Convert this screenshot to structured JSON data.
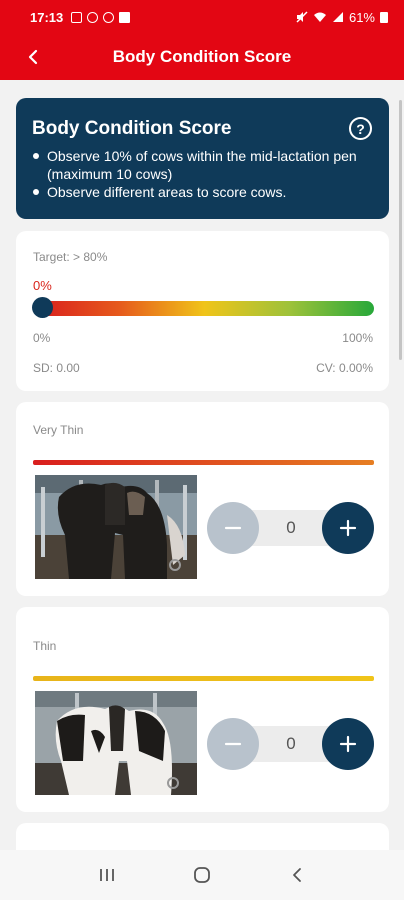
{
  "status_bar": {
    "time": "17:13",
    "battery": "61%"
  },
  "header": {
    "title": "Body Condition Score"
  },
  "info": {
    "title": "Body Condition Score",
    "help_glyph": "?",
    "bullets": [
      "Observe 10% of cows within the mid-lactation pen (maximum 10 cows)",
      "Observe different areas to score cows."
    ]
  },
  "summary": {
    "target": "Target: > 80%",
    "current_percent": "0%",
    "progress_fraction": 0,
    "scale_min": "0%",
    "scale_max": "100%",
    "sd": "SD: 0.00",
    "cv": "CV: 0.00%"
  },
  "scores": [
    {
      "label": "Very Thin",
      "count": "0",
      "line_gradient": [
        "#d91e1e",
        "#e67e22"
      ]
    },
    {
      "label": "Thin",
      "count": "0",
      "line_gradient": [
        "#e8b41a",
        "#f0c419"
      ]
    }
  ],
  "colors": {
    "brand_red": "#e30613",
    "navy": "#0f3a59",
    "minus_button": "#b8c2cc",
    "gradient": [
      "#d91e1e",
      "#e65a1c",
      "#f0c419",
      "#9ec23a",
      "#27a83a"
    ]
  },
  "icons": {
    "back": "back-arrow-icon",
    "help": "help-icon",
    "minus": "minus-icon",
    "plus": "plus-icon",
    "nav": [
      "recent-apps-icon",
      "home-icon",
      "nav-back-icon"
    ]
  }
}
